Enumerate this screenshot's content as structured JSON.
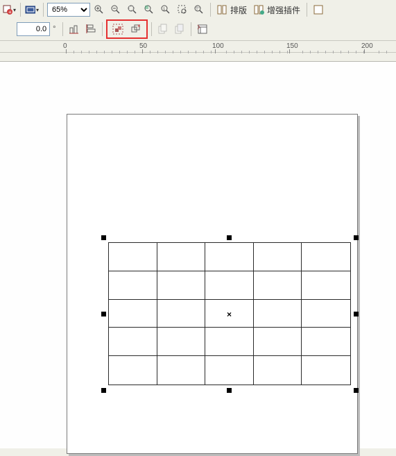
{
  "toolbar1": {
    "zoom_value": "65%",
    "layout_label": "排版",
    "enhance_label": "增强插件"
  },
  "toolbar2": {
    "rotation_value": "0.0"
  },
  "ruler": {
    "ticks": [
      "0",
      "50",
      "100",
      "150",
      "200"
    ]
  },
  "table": {
    "rows": 5,
    "cols": 5
  },
  "icons": {
    "new_obj": "new-object",
    "frame": "frame",
    "zoomin": "zoom-in",
    "zoomout": "zoom-out",
    "zoomall": "zoom-fit",
    "zoomsel": "zoom-selection",
    "zoom1": "zoom-1",
    "marquee": "marquee",
    "pan": "pan",
    "layout_pages": "layout-pages",
    "plugin": "plugin",
    "misc": "misc",
    "halign": "h-align",
    "valign": "v-align",
    "ungroup": "ungroup",
    "remove_group": "remove-group",
    "copy1": "copy",
    "copy2": "paste",
    "preview": "preview"
  }
}
